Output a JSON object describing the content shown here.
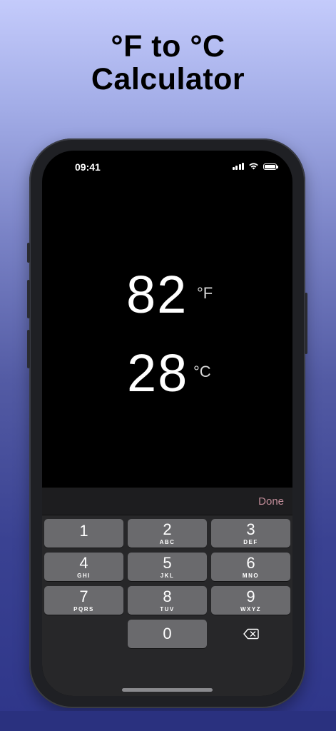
{
  "headline": {
    "line1": "°F to °C",
    "line2": "Calculator"
  },
  "status_bar": {
    "time": "09:41"
  },
  "converter": {
    "fahrenheit_value": "82",
    "fahrenheit_unit": "°F",
    "celsius_value": "28",
    "celsius_unit": "°C"
  },
  "keyboard": {
    "done_label": "Done",
    "keys": [
      {
        "digit": "1",
        "letters": ""
      },
      {
        "digit": "2",
        "letters": "ABC"
      },
      {
        "digit": "3",
        "letters": "DEF"
      },
      {
        "digit": "4",
        "letters": "GHI"
      },
      {
        "digit": "5",
        "letters": "JKL"
      },
      {
        "digit": "6",
        "letters": "MNO"
      },
      {
        "digit": "7",
        "letters": "PQRS"
      },
      {
        "digit": "8",
        "letters": "TUV"
      },
      {
        "digit": "9",
        "letters": "WXYZ"
      },
      {
        "digit": "0",
        "letters": ""
      }
    ]
  },
  "colors": {
    "done_accent": "#c08c98",
    "key_bg": "#6a6a6d",
    "keyboard_bg": "#272729"
  }
}
